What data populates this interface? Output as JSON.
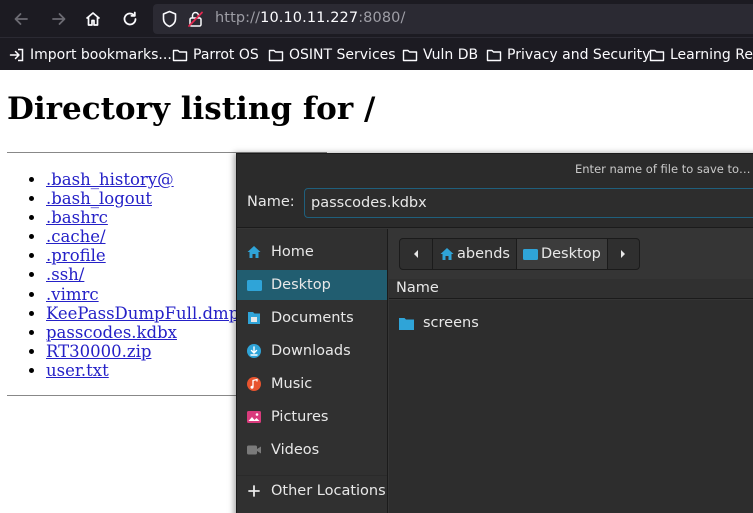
{
  "browser": {
    "url_scheme": "http://",
    "url_host": "10.10.11.227",
    "url_rest": ":8080/",
    "bookmarks": [
      {
        "label": "Import bookmarks...",
        "icon": "import-icon"
      },
      {
        "label": "Parrot OS",
        "icon": "folder-icon"
      },
      {
        "label": "OSINT Services",
        "icon": "folder-icon"
      },
      {
        "label": "Vuln DB",
        "icon": "folder-icon"
      },
      {
        "label": "Privacy and Security",
        "icon": "folder-icon"
      },
      {
        "label": "Learning Res",
        "icon": "folder-icon"
      }
    ]
  },
  "page": {
    "title": "Directory listing for /",
    "files": [
      ".bash_history@",
      ".bash_logout",
      ".bashrc",
      ".cache/",
      ".profile",
      ".ssh/",
      ".vimrc",
      "KeePassDumpFull.dmp",
      "passcodes.kdbx",
      "RT30000.zip",
      "user.txt"
    ]
  },
  "dialog": {
    "title": "Enter name of file to save to…",
    "name_label": "Name:",
    "name_value": "passcodes.kdbx",
    "sidebar": [
      {
        "label": "Home",
        "icon": "home-icon",
        "active": false
      },
      {
        "label": "Desktop",
        "icon": "desktop-icon",
        "active": true
      },
      {
        "label": "Documents",
        "icon": "documents-icon",
        "active": false
      },
      {
        "label": "Downloads",
        "icon": "downloads-icon",
        "active": false
      },
      {
        "label": "Music",
        "icon": "music-icon",
        "active": false
      },
      {
        "label": "Pictures",
        "icon": "pictures-icon",
        "active": false
      },
      {
        "label": "Videos",
        "icon": "videos-icon",
        "active": false
      },
      {
        "label": "Other Locations",
        "icon": "plus-icon",
        "active": false
      }
    ],
    "path": [
      "abends",
      "Desktop"
    ],
    "column_name": "Name",
    "entries": [
      {
        "name": "screens",
        "icon": "folder-icon"
      }
    ]
  },
  "colors": {
    "accent": "#215d70",
    "folder": "#2fa4d8",
    "link": "#2521c7"
  }
}
